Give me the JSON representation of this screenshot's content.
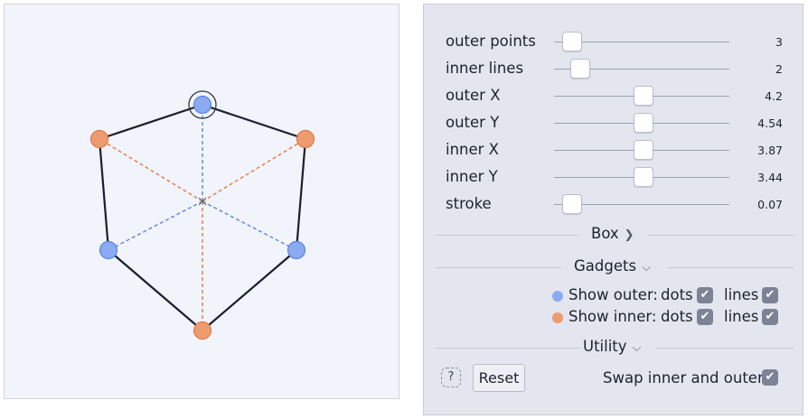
{
  "colors": {
    "outer": "#8aabf2",
    "outer_stroke": "#5b84e0",
    "inner": "#ee9b70",
    "inner_stroke": "#e07a45",
    "shape": "#1b1e2e",
    "canvas_bg": "#f1f4fa"
  },
  "sliders": [
    {
      "key": "outer_points",
      "label": "outer points",
      "value": "3",
      "level": 0.0
    },
    {
      "key": "inner_lines",
      "label": "inner lines",
      "value": "2",
      "level": 0.06
    },
    {
      "key": "outer_x",
      "label": "outer X",
      "value": "4.2",
      "level": 0.51
    },
    {
      "key": "outer_y",
      "label": "outer Y",
      "value": "4.54",
      "level": 0.515
    },
    {
      "key": "inner_x",
      "label": "inner X",
      "value": "3.87",
      "level": 0.515
    },
    {
      "key": "inner_y",
      "label": "inner Y",
      "value": "3.44",
      "level": 0.515
    },
    {
      "key": "stroke",
      "label": "stroke",
      "value": "0.07",
      "level": 0.0
    }
  ],
  "sections": {
    "box": {
      "label": "Box",
      "icon": "chevron-right-icon",
      "expanded": false
    },
    "gadgets": {
      "label": "Gadgets",
      "icon": "chevron-down-icon",
      "expanded": true
    },
    "utility": {
      "label": "Utility",
      "icon": "chevron-down-icon",
      "expanded": true
    }
  },
  "gadgets": {
    "outer": {
      "label": "Show outer:",
      "dots_label": "dots",
      "lines_label": "lines",
      "dots_checked": true,
      "lines_checked": true
    },
    "inner": {
      "label": "Show inner:",
      "dots_label": "dots",
      "lines_label": "lines",
      "dots_checked": true,
      "lines_checked": true
    }
  },
  "utility": {
    "help_label": "?",
    "reset_label": "Reset",
    "swap_label": "Swap inner and outer",
    "swap_checked": true
  }
}
